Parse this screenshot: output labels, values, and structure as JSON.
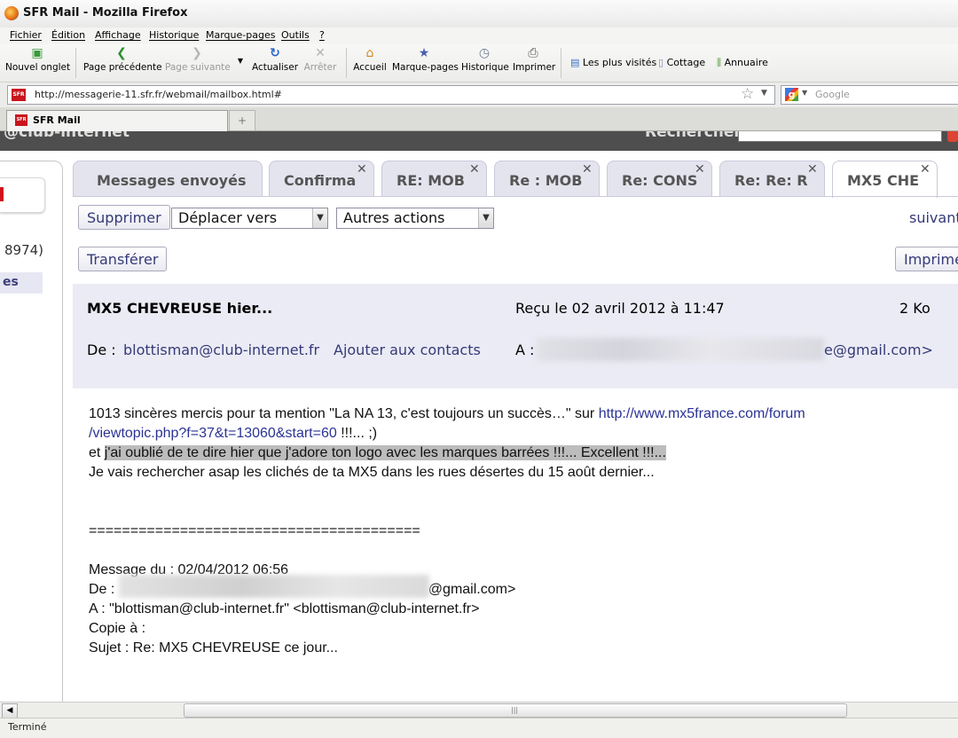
{
  "window": {
    "title": "SFR Mail - Mozilla Firefox"
  },
  "menu": [
    "Fichier",
    "Édition",
    "Affichage",
    "Historique",
    "Marque-pages",
    "Outils",
    "?"
  ],
  "toolbar": {
    "new_tab": "Nouvel onglet",
    "back": "Page précédente",
    "forward": "Page suivante",
    "reload": "Actualiser",
    "stop": "Arrêter",
    "home": "Accueil",
    "bookmarks": "Marque-pages",
    "history": "Historique",
    "print": "Imprimer"
  },
  "bookmarks_bar": [
    "Les plus visités",
    "Cottage",
    "Annuaire"
  ],
  "address": {
    "favicon": "SFR",
    "url": "http://messagerie-11.sfr.fr/webmail/mailbox.html#",
    "search_placeholder": "Google"
  },
  "browser_tab": {
    "favicon": "SFR",
    "label": "SFR Mail"
  },
  "page": {
    "header_left": "@club-internet",
    "header_right": "Rechercher",
    "left_count": "8974)",
    "left_selected": "es",
    "mail_tabs": [
      {
        "label": "Messages envoyés",
        "closable": false,
        "active": false
      },
      {
        "label": "Confirma",
        "closable": true,
        "active": false
      },
      {
        "label": "RE: MOB",
        "closable": true,
        "active": false
      },
      {
        "label": "Re : MOB",
        "closable": true,
        "active": false
      },
      {
        "label": "Re: CONS",
        "closable": true,
        "active": false
      },
      {
        "label": "Re: Re: R",
        "closable": true,
        "active": false
      },
      {
        "label": "MX5 CHE",
        "closable": true,
        "active": true
      }
    ],
    "actions": {
      "delete": "Supprimer",
      "move": "Déplacer vers",
      "other": "Autres actions",
      "next": "suivant",
      "forward": "Transférer",
      "print": "Imprime"
    },
    "message": {
      "subject": "MX5 CHEVREUSE hier...",
      "received": "Reçu le 02 avril 2012 à 11:47",
      "size": "2 Ko",
      "from_label": "De :",
      "from": "blottisman@club-internet.fr",
      "add_contact": "Ajouter aux contacts",
      "to_label": "A :",
      "to_suffix": "e@gmail.com>"
    },
    "body": {
      "l1_a": "1013 sincères mercis pour ta mention \"La NA 13, c'est toujours un succès…\"  sur ",
      "l1_link": "http://www.mx5france.com/forum",
      "l2_link": "/viewtopic.php?f=37&t=13060&start=60",
      "l2_b": " !!!...  ;)",
      "l3_a": "et ",
      "l3_hl": "j'ai oublié de te dire hier que j'adore ton logo avec les marques barrées !!!... Excellent !!!...",
      "l4": "Je vais rechercher asap les clichés de ta MX5 dans les rues désertes du 15 août dernier...",
      "separator": "========================================",
      "q1": "Message du : 02/04/2012 06:56",
      "q2_label": "De : ",
      "q2_suffix": "@gmail.com>",
      "q3": "A : \"blottisman@club-internet.fr\" <blottisman@club-internet.fr>",
      "q4": "Copie à :",
      "q5": "Sujet : Re: MX5 CHEVREUSE ce jour..."
    }
  },
  "status": "Terminé"
}
